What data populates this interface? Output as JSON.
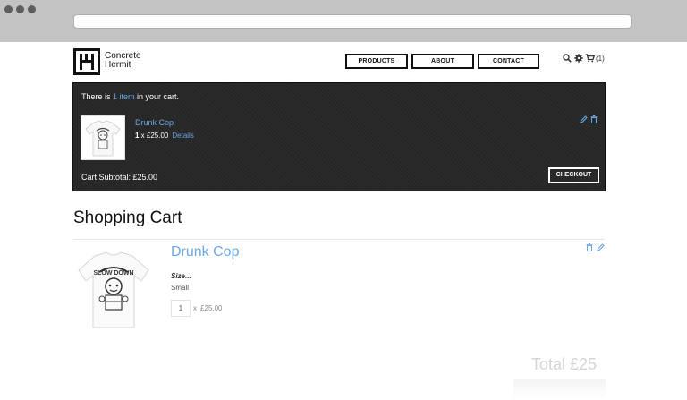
{
  "brand": {
    "line1": "Concrete",
    "line2": "Hermit"
  },
  "nav": [
    "PRODUCTS",
    "ABOUT",
    "CONTACT"
  ],
  "header": {
    "cart_count": "(1)",
    "search_icon": "search-icon",
    "settings_icon": "gear-icon",
    "cart_icon": "cart-icon"
  },
  "minicart": {
    "msg_prefix": "There is ",
    "msg_link": "1 item",
    "msg_suffix": " in your cart.",
    "item_name": "Drunk Cop",
    "qty": "1",
    "qty_rest": " x £25.00",
    "details": "Details",
    "subtotal": "Cart Subtotal: £25.00",
    "checkout": "CHECKOUT"
  },
  "cart": {
    "title": "Shopping Cart",
    "item_name": "Drunk Cop",
    "option_label": "Size...",
    "option_value": "Small",
    "qty": "1",
    "x": "x",
    "price": "£25.00",
    "total": "Total £25"
  },
  "colors": {
    "link": "#6aa7e6",
    "panel": "#262626",
    "chrome": "#c3c3c3"
  }
}
